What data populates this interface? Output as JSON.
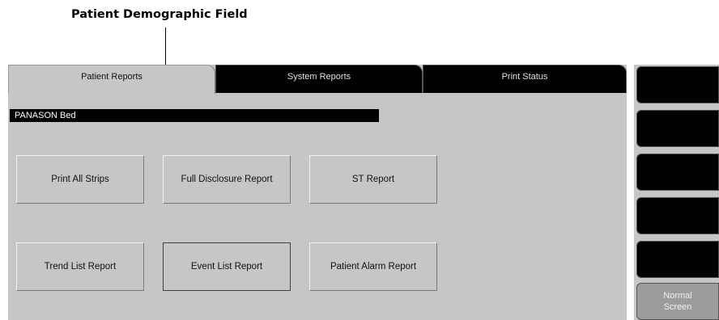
{
  "callout": {
    "label": "Patient Demographic Field"
  },
  "tabs": [
    {
      "label": "Patient Reports",
      "active": true
    },
    {
      "label": "System Reports",
      "active": false
    },
    {
      "label": "Print Status",
      "active": false
    }
  ],
  "demographic_field": {
    "value": "PANASON Bed"
  },
  "report_buttons": [
    {
      "label": "Print All Strips"
    },
    {
      "label": "Full Disclosure Report"
    },
    {
      "label": "ST Report"
    },
    {
      "label": "Trend List Report"
    },
    {
      "label": "Event List Report"
    },
    {
      "label": "Patient Alarm Report"
    }
  ],
  "softkeys": {
    "normal_screen": {
      "line1": "Normal",
      "line2": "Screen"
    }
  }
}
